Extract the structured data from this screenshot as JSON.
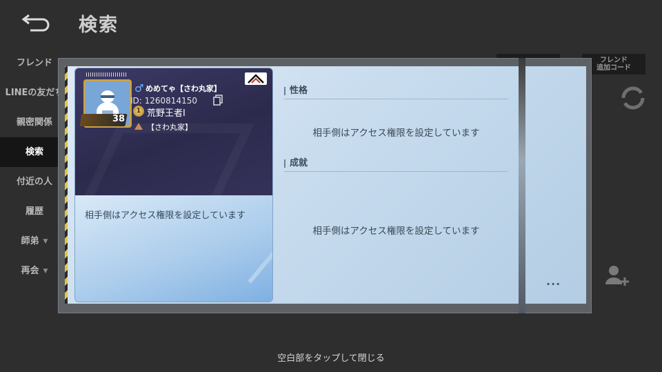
{
  "background": {
    "title": "検索",
    "nav_items": [
      {
        "label": "フレンド",
        "active": false,
        "caret": false
      },
      {
        "label": "LINEの友だち",
        "active": false,
        "caret": false
      },
      {
        "label": "親密関係",
        "active": false,
        "caret": false
      },
      {
        "label": "検索",
        "active": true,
        "caret": false
      },
      {
        "label": "付近の人",
        "active": false,
        "caret": false
      },
      {
        "label": "履歴",
        "active": false,
        "caret": false
      },
      {
        "label": "師弟",
        "active": false,
        "caret": true
      },
      {
        "label": "再会",
        "active": false,
        "caret": true
      }
    ],
    "friend_code_button": "フレンド\n追加コード",
    "close_hint": "空白部をタップして閉じる"
  },
  "profile": {
    "gender_symbol": "♂",
    "name": "めめてゃ【さわ丸家】",
    "id_text": "ID: 1260814150",
    "level": "38",
    "rank_text": "荒野王者Ⅰ",
    "rank_badge": "1",
    "clan": "【さわ丸家】",
    "access_message": "相手側はアクセス権限を設定しています"
  },
  "sections": [
    {
      "title": "性格",
      "message": "相手側はアクセス権限を設定しています"
    },
    {
      "title": "成就",
      "message": "相手側はアクセス権限を設定しています"
    }
  ],
  "more_label": "...",
  "colors": {
    "card_top": "#2c2a4c",
    "card_bottom": "#a9cbeb",
    "panel": "#c8dcee",
    "gender": "#6fb7ff",
    "frame_gold": "#c9a24a"
  }
}
